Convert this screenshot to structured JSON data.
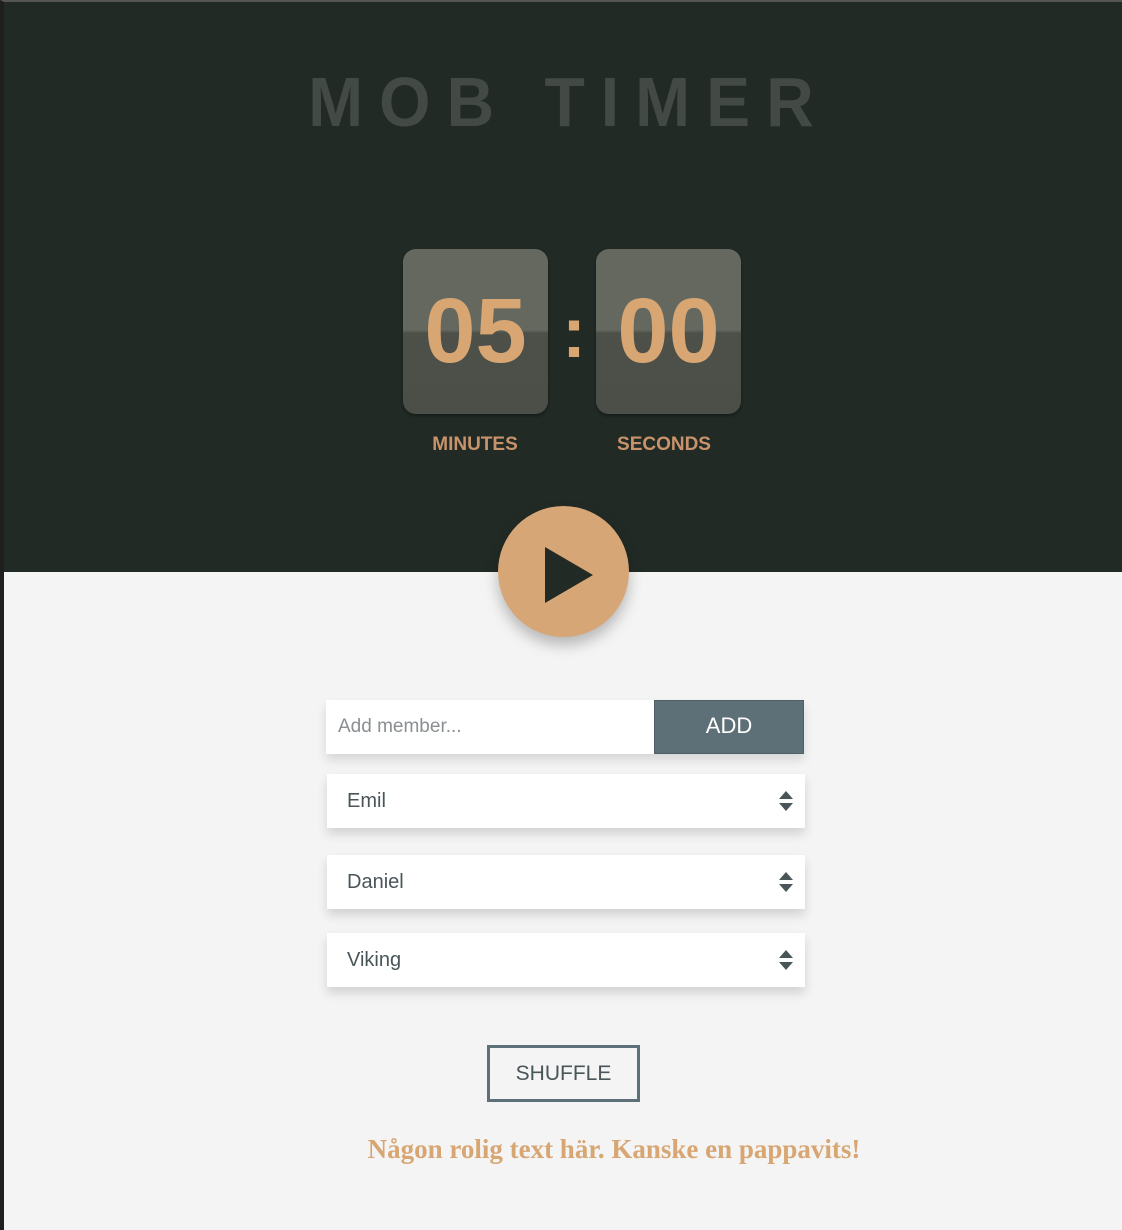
{
  "app": {
    "title": "MOB TIMER"
  },
  "timer": {
    "minutes": "05",
    "seconds": "00",
    "separator": ":",
    "minutes_label": "MINUTES",
    "seconds_label": "SECONDS",
    "play_icon": "play-icon"
  },
  "add_member": {
    "placeholder": "Add member...",
    "value": "",
    "button_label": "ADD"
  },
  "members": [
    {
      "name": "Emil",
      "icon": "sort-handle-icon"
    },
    {
      "name": "Daniel",
      "icon": "sort-handle-icon"
    },
    {
      "name": "Viking",
      "icon": "sort-handle-icon"
    }
  ],
  "shuffle_label": "SHUFFLE",
  "joke_text": "Någon rolig text här. Kanske en pappavits!",
  "colors": {
    "hero_bg": "#222a26",
    "accent": "#d7a673",
    "button_slate": "#5e7077",
    "page_bg": "#f4f4f4"
  }
}
